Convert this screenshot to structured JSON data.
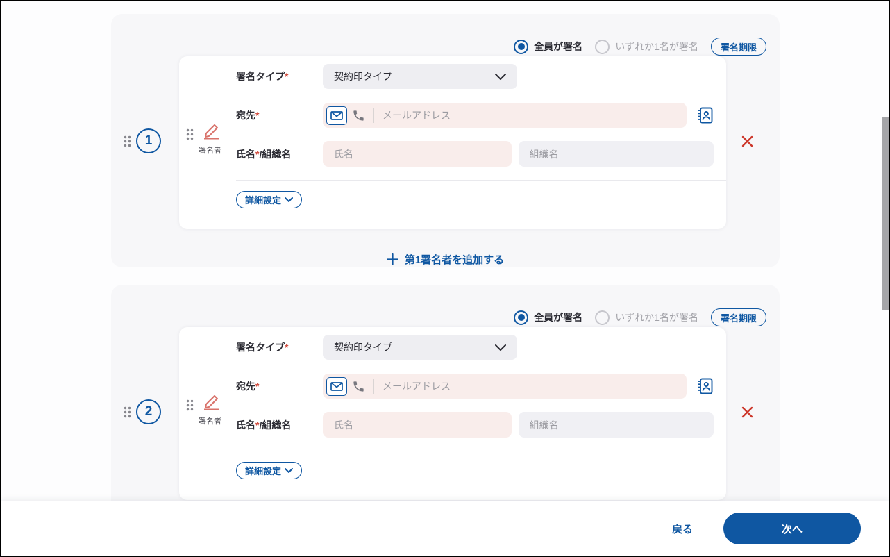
{
  "colors": {
    "primary_blue": "#0f57a2",
    "danger_red": "#cc372b",
    "pencil_salmon": "#d9736b",
    "required_field_bg": "#f9edeb",
    "optional_field_bg": "#f0f0f4",
    "group_card_bg": "#f7f7f9"
  },
  "icons": {
    "email": "envelope-icon",
    "phone": "phone-icon",
    "address_book": "address-book-icon",
    "drag": "six-dots-drag-handle",
    "signer": "pencil-icon",
    "remove": "x-icon",
    "add": "plus-icon",
    "expand": "chevron-down-icon"
  },
  "ui": {
    "required_marker": "*"
  },
  "footer": {
    "back_label": "戻る",
    "next_label": "次へ"
  },
  "groups": [
    {
      "number": "1",
      "signing_rule_options": [
        {
          "label": "全員が署名",
          "selected": true
        },
        {
          "label": "いずれか1名が署名",
          "selected": false
        }
      ],
      "deadline_button_label": "署名期限",
      "signer_tag_label": "署名者",
      "sign_type_label": "署名タイプ",
      "sign_type_value": "契約印タイプ",
      "recipient_label": "宛先",
      "recipient_placeholder": "メールアドレス",
      "name_label_name": "氏名",
      "name_label_org": "/組織名",
      "name_placeholder": "氏名",
      "org_placeholder": "組織名",
      "advanced_settings_label": "詳細設定",
      "add_signer_label": "第1署名者を追加する"
    },
    {
      "number": "2",
      "signing_rule_options": [
        {
          "label": "全員が署名",
          "selected": true
        },
        {
          "label": "いずれか1名が署名",
          "selected": false
        }
      ],
      "deadline_button_label": "署名期限",
      "signer_tag_label": "署名者",
      "sign_type_label": "署名タイプ",
      "sign_type_value": "契約印タイプ",
      "recipient_label": "宛先",
      "recipient_placeholder": "メールアドレス",
      "name_label_name": "氏名",
      "name_label_org": "/組織名",
      "name_placeholder": "氏名",
      "org_placeholder": "組織名",
      "advanced_settings_label": "詳細設定"
    }
  ]
}
